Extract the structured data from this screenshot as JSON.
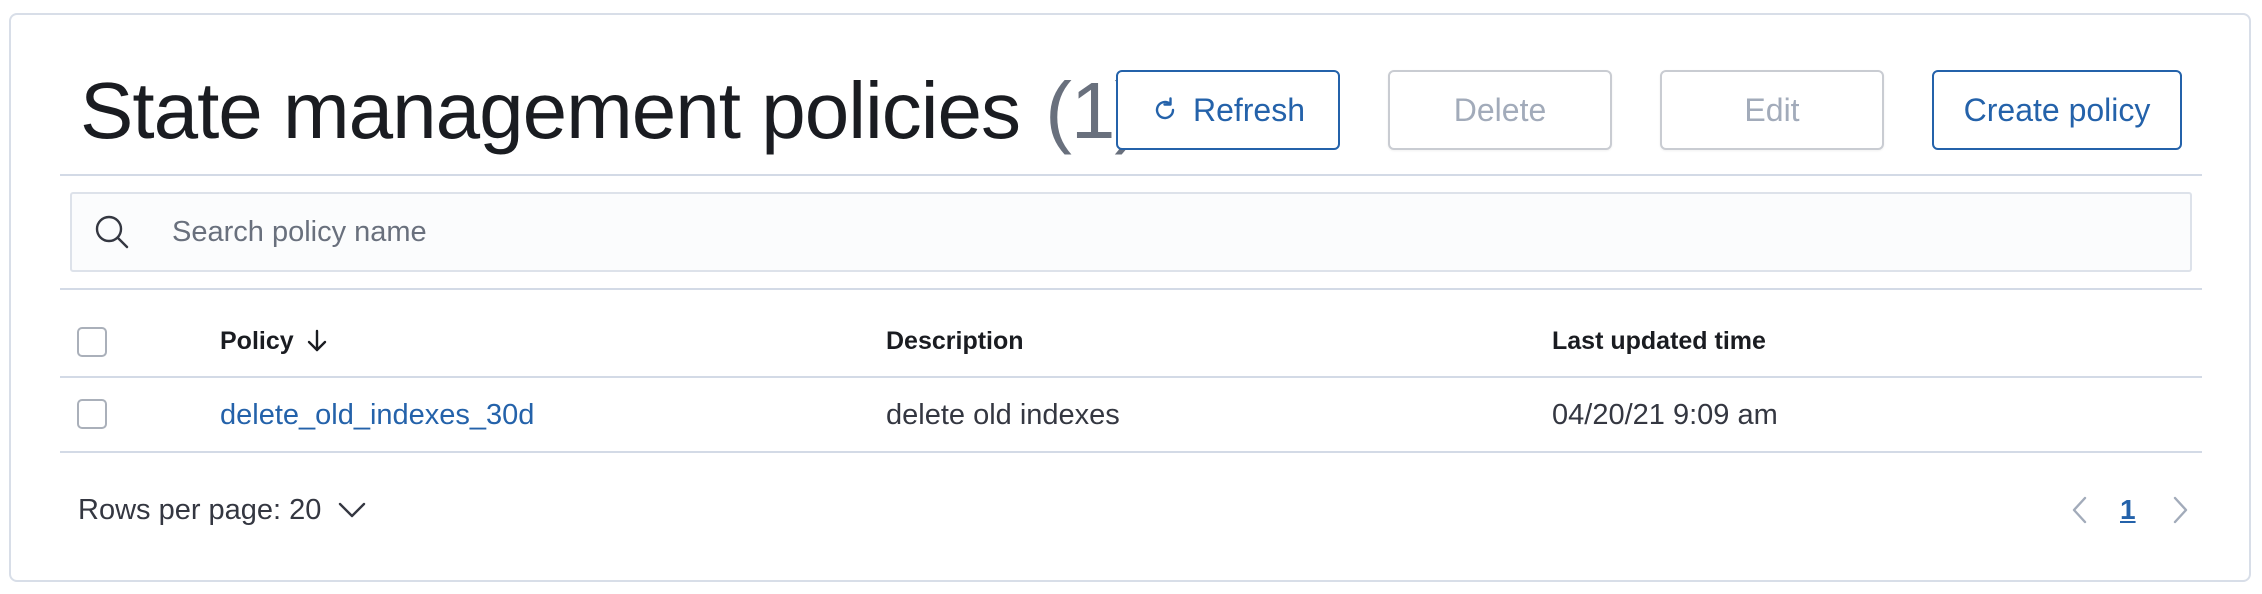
{
  "header": {
    "title": "State management policies",
    "count": "(1)"
  },
  "toolbar": {
    "refresh_label": "Refresh",
    "delete_label": "Delete",
    "edit_label": "Edit",
    "create_label": "Create policy"
  },
  "search": {
    "placeholder": "Search policy name",
    "value": "",
    "icon": "search-icon"
  },
  "table": {
    "columns": [
      "Policy",
      "Description",
      "Last updated time"
    ],
    "sort": {
      "column": "Policy",
      "direction": "descending"
    },
    "rows": [
      {
        "policy": "delete_old_indexes_30d",
        "description": "delete old indexes",
        "last_updated": "04/20/21 9:09 am"
      }
    ]
  },
  "pagination": {
    "rows_per_page_label": "Rows per page: 20",
    "current_page": "1"
  },
  "colors": {
    "accent": "#2462aa",
    "disabled_text": "#a2abba",
    "border": "#d3dae6"
  }
}
